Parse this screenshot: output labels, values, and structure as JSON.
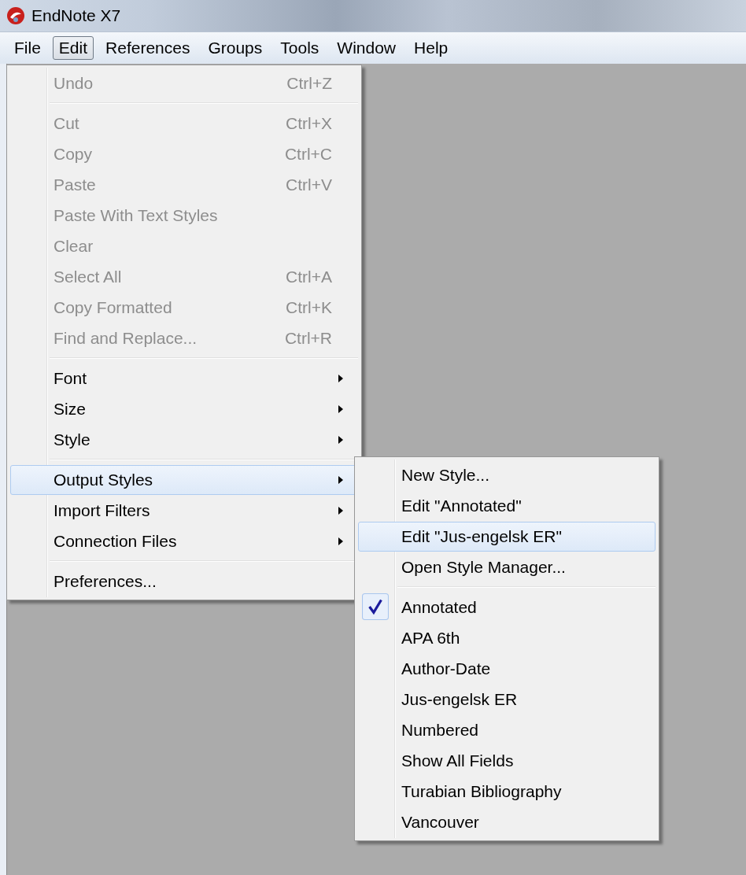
{
  "window": {
    "title": "EndNote X7"
  },
  "menu_bar": [
    {
      "label": "File",
      "selected": false
    },
    {
      "label": "Edit",
      "selected": true
    },
    {
      "label": "References",
      "selected": false
    },
    {
      "label": "Groups",
      "selected": false
    },
    {
      "label": "Tools",
      "selected": false
    },
    {
      "label": "Window",
      "selected": false
    },
    {
      "label": "Help",
      "selected": false
    }
  ],
  "edit_menu": {
    "items": [
      {
        "kind": "item",
        "label": "Undo",
        "shortcut": "Ctrl+Z",
        "disabled": true,
        "highlighted": false,
        "has_submenu": false
      },
      {
        "kind": "separator"
      },
      {
        "kind": "item",
        "label": "Cut",
        "shortcut": "Ctrl+X",
        "disabled": true,
        "highlighted": false,
        "has_submenu": false
      },
      {
        "kind": "item",
        "label": "Copy",
        "shortcut": "Ctrl+C",
        "disabled": true,
        "highlighted": false,
        "has_submenu": false
      },
      {
        "kind": "item",
        "label": "Paste",
        "shortcut": "Ctrl+V",
        "disabled": true,
        "highlighted": false,
        "has_submenu": false
      },
      {
        "kind": "item",
        "label": "Paste With Text Styles",
        "disabled": true,
        "highlighted": false,
        "has_submenu": false
      },
      {
        "kind": "item",
        "label": "Clear",
        "disabled": true,
        "highlighted": false,
        "has_submenu": false
      },
      {
        "kind": "item",
        "label": "Select All",
        "shortcut": "Ctrl+A",
        "disabled": true,
        "highlighted": false,
        "has_submenu": false
      },
      {
        "kind": "item",
        "label": "Copy Formatted",
        "shortcut": "Ctrl+K",
        "disabled": true,
        "highlighted": false,
        "has_submenu": false
      },
      {
        "kind": "item",
        "label": "Find and Replace...",
        "shortcut": "Ctrl+R",
        "disabled": true,
        "highlighted": false,
        "has_submenu": false
      },
      {
        "kind": "separator"
      },
      {
        "kind": "item",
        "label": "Font",
        "disabled": false,
        "highlighted": false,
        "has_submenu": true
      },
      {
        "kind": "item",
        "label": "Size",
        "disabled": false,
        "highlighted": false,
        "has_submenu": true
      },
      {
        "kind": "item",
        "label": "Style",
        "disabled": false,
        "highlighted": false,
        "has_submenu": true
      },
      {
        "kind": "separator"
      },
      {
        "kind": "item",
        "label": "Output Styles",
        "disabled": false,
        "highlighted": true,
        "has_submenu": true
      },
      {
        "kind": "item",
        "label": "Import Filters",
        "disabled": false,
        "highlighted": false,
        "has_submenu": true
      },
      {
        "kind": "item",
        "label": "Connection Files",
        "disabled": false,
        "highlighted": false,
        "has_submenu": true
      },
      {
        "kind": "separator"
      },
      {
        "kind": "item",
        "label": "Preferences...",
        "disabled": false,
        "highlighted": false,
        "has_submenu": false
      }
    ]
  },
  "output_styles_submenu": {
    "items": [
      {
        "kind": "item",
        "label": "New Style...",
        "checked": false,
        "highlighted": false
      },
      {
        "kind": "item",
        "label": "Edit \"Annotated\"",
        "checked": false,
        "highlighted": false
      },
      {
        "kind": "item",
        "label": "Edit \"Jus-engelsk ER\"",
        "checked": false,
        "highlighted": true
      },
      {
        "kind": "item",
        "label": "Open Style Manager...",
        "checked": false,
        "highlighted": false
      },
      {
        "kind": "separator"
      },
      {
        "kind": "item",
        "label": "Annotated",
        "checked": true,
        "highlighted": false
      },
      {
        "kind": "item",
        "label": "APA 6th",
        "checked": false,
        "highlighted": false
      },
      {
        "kind": "item",
        "label": "Author-Date",
        "checked": false,
        "highlighted": false
      },
      {
        "kind": "item",
        "label": "Jus-engelsk ER",
        "checked": false,
        "highlighted": false
      },
      {
        "kind": "item",
        "label": "Numbered",
        "checked": false,
        "highlighted": false
      },
      {
        "kind": "item",
        "label": "Show All Fields",
        "checked": false,
        "highlighted": false
      },
      {
        "kind": "item",
        "label": "Turabian Bibliography",
        "checked": false,
        "highlighted": false
      },
      {
        "kind": "item",
        "label": "Vancouver",
        "checked": false,
        "highlighted": false
      }
    ]
  }
}
